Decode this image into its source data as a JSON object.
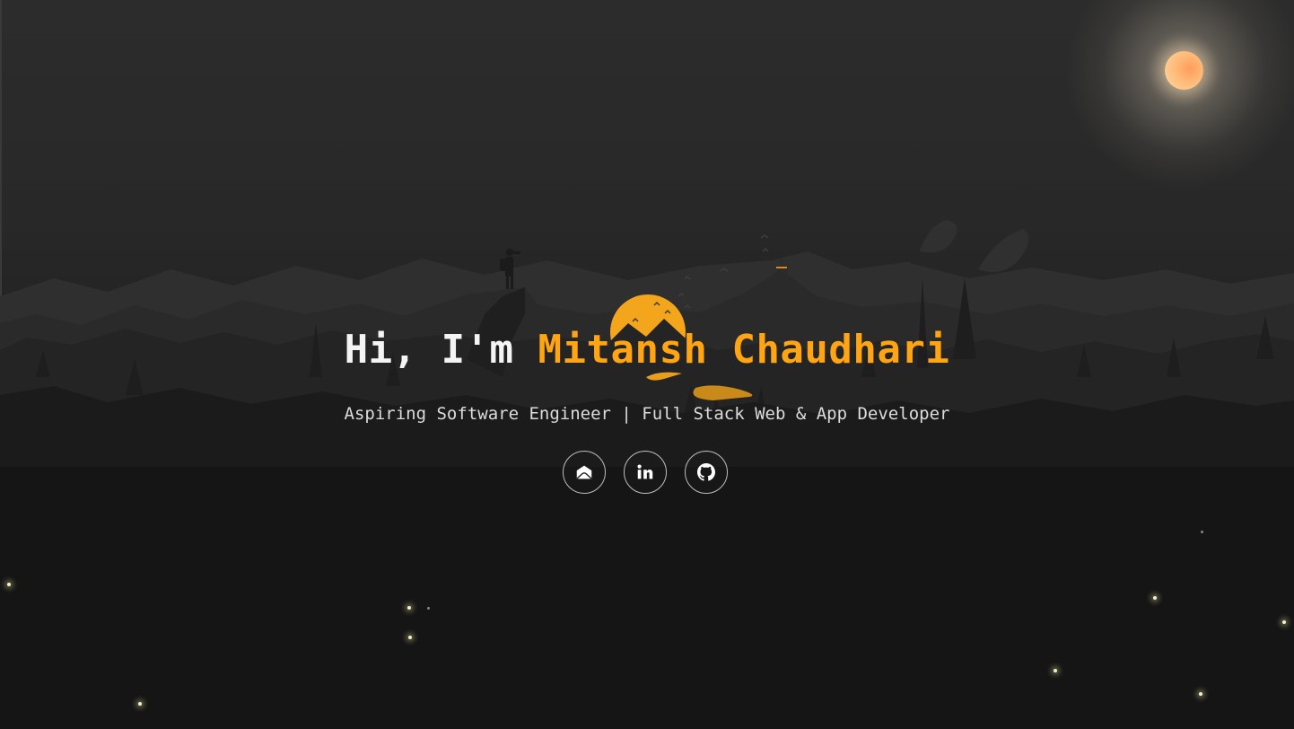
{
  "hero": {
    "greeting": "Hi, I'm ",
    "name": "Mitansh Chaudhari",
    "tagline": "Aspiring Software Engineer | Full Stack Web & App Developer"
  },
  "social_links": [
    {
      "label": "Email",
      "icon": "mail-icon"
    },
    {
      "label": "LinkedIn",
      "icon": "linkedin-icon"
    },
    {
      "label": "GitHub",
      "icon": "github-icon"
    }
  ],
  "colors": {
    "accent": "#ffa412",
    "headline": "#f4f4f4",
    "tagline": "#dcdcdc",
    "background": "#151515",
    "moon": "#ffb877"
  }
}
